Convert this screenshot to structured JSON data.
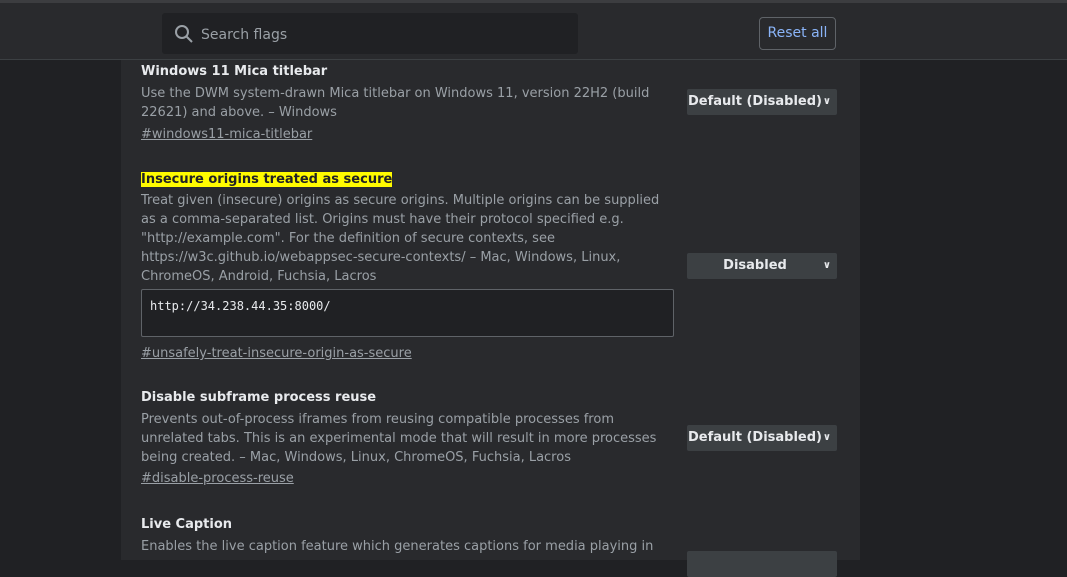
{
  "search": {
    "placeholder": "Search flags",
    "reset_label": "Reset all"
  },
  "flags": [
    {
      "title": "Windows 11 Mica titlebar",
      "description": "Use the DWM system-drawn Mica titlebar on Windows 11, version 22H2 (build 22621) and above. – Windows",
      "link": "#windows11-mica-titlebar",
      "selected": "Default (Disabled)"
    },
    {
      "title": "Insecure origins treated as secure",
      "description": "Treat given (insecure) origins as secure origins. Multiple origins can be supplied as a comma-separated list. Origins must have their protocol specified e.g. \"http://example.com\". For the definition of secure contexts, see https://w3c.github.io/webappsec-secure-contexts/ – Mac, Windows, Linux, ChromeOS, Android, Fuchsia, Lacros",
      "input_value": "http://34.238.44.35:8000/",
      "link": "#unsafely-treat-insecure-origin-as-secure",
      "selected": "Disabled"
    },
    {
      "title": "Disable subframe process reuse",
      "description": "Prevents out-of-process iframes from reusing compatible processes from unrelated tabs. This is an experimental mode that will result in more processes being created. – Mac, Windows, Linux, ChromeOS, Fuchsia, Lacros",
      "link": "#disable-process-reuse",
      "selected": "Default (Disabled)"
    },
    {
      "title": "Live Caption",
      "description": "Enables the live caption feature which generates captions for media playing in"
    }
  ],
  "colors": {
    "highlight": "#fffb00",
    "accent": "#8ab4f8",
    "background": "#202124",
    "panel": "#292a2d"
  }
}
